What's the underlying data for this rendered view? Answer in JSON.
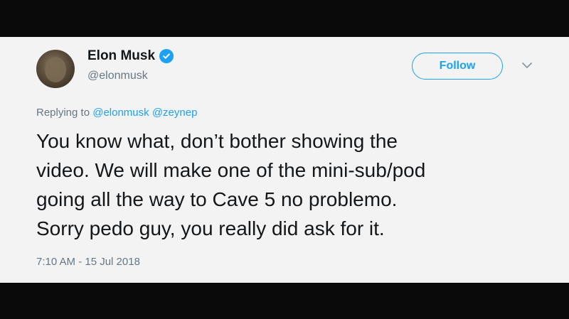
{
  "tweet": {
    "author": {
      "name": "Elon Musk",
      "handle": "@elonmusk",
      "verified": true
    },
    "follow_label": "Follow",
    "replying": {
      "prefix": "Replying to",
      "mentions": [
        "@elonmusk",
        "@zeynep"
      ]
    },
    "text_lines": [
      "You know what, don’t bother showing the",
      "video. We will make one of the mini-sub/pod",
      "going all the way to Cave 5 no problemo.",
      "Sorry pedo guy, you really did ask for it."
    ],
    "timestamp": "7:10 AM - 15 Jul 2018"
  },
  "colors": {
    "accent": "#1da1f2",
    "card_background": "#f3f3f3",
    "frame_background": "#0a0a0a",
    "text_primary": "#14171a",
    "text_secondary": "#657786"
  },
  "icons": [
    "verified-badge-icon",
    "chevron-down-icon"
  ]
}
